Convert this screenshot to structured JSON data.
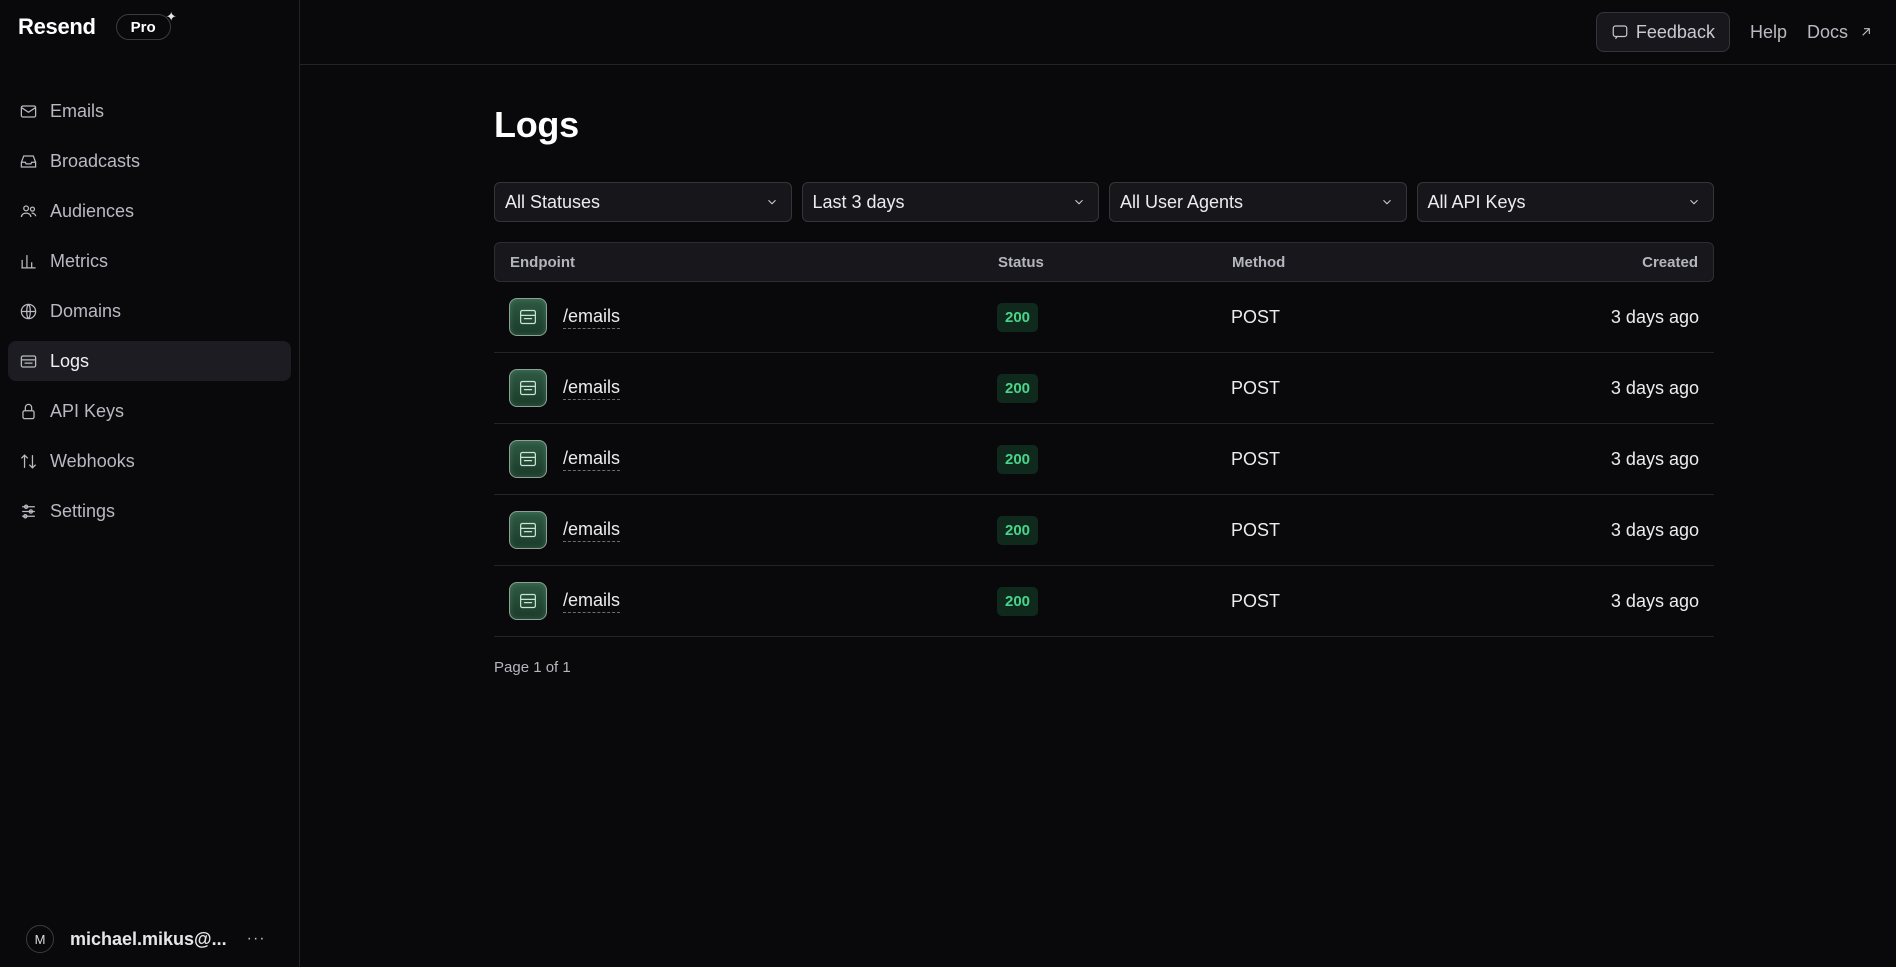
{
  "brand": {
    "name": "Resend",
    "plan": "Pro"
  },
  "nav": [
    {
      "label": "Emails",
      "icon": "mail-icon",
      "active": false
    },
    {
      "label": "Broadcasts",
      "icon": "inbox-icon",
      "active": false
    },
    {
      "label": "Audiences",
      "icon": "users-icon",
      "active": false
    },
    {
      "label": "Metrics",
      "icon": "bar-chart-icon",
      "active": false
    },
    {
      "label": "Domains",
      "icon": "globe-icon",
      "active": false
    },
    {
      "label": "Logs",
      "icon": "logs-icon",
      "active": true
    },
    {
      "label": "API Keys",
      "icon": "lock-icon",
      "active": false
    },
    {
      "label": "Webhooks",
      "icon": "arrows-icon",
      "active": false
    },
    {
      "label": "Settings",
      "icon": "sliders-icon",
      "active": false
    }
  ],
  "user": {
    "initial": "M",
    "name": "michael.mikus@...",
    "more": "···"
  },
  "topbar": {
    "feedback": "Feedback",
    "help": "Help",
    "docs": "Docs"
  },
  "page": {
    "title": "Logs"
  },
  "filters": [
    {
      "value": "All Statuses"
    },
    {
      "value": "Last 3 days"
    },
    {
      "value": "All User Agents"
    },
    {
      "value": "All API Keys"
    }
  ],
  "table": {
    "headers": {
      "endpoint": "Endpoint",
      "status": "Status",
      "method": "Method",
      "created": "Created"
    },
    "rows": [
      {
        "endpoint": "/emails",
        "status": "200",
        "method": "POST",
        "created": "3 days ago"
      },
      {
        "endpoint": "/emails",
        "status": "200",
        "method": "POST",
        "created": "3 days ago"
      },
      {
        "endpoint": "/emails",
        "status": "200",
        "method": "POST",
        "created": "3 days ago"
      },
      {
        "endpoint": "/emails",
        "status": "200",
        "method": "POST",
        "created": "3 days ago"
      },
      {
        "endpoint": "/emails",
        "status": "200",
        "method": "POST",
        "created": "3 days ago"
      }
    ]
  },
  "pagination": {
    "text": "Page 1 of 1"
  },
  "colors": {
    "background": "#09090c",
    "status_ok": "#4ad48a",
    "status_ok_bg": "#0f2a1c"
  }
}
